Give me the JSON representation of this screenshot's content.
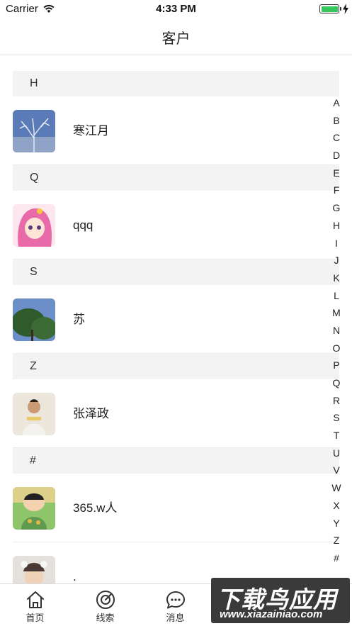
{
  "status_bar": {
    "carrier": "Carrier",
    "time": "4:33 PM",
    "battery_percent": 100,
    "battery_color": "#35c759"
  },
  "nav": {
    "title": "客户"
  },
  "sections": [
    {
      "letter": "H",
      "contacts": [
        {
          "name": "寒江月",
          "avatar": "winter-tree-photo"
        }
      ]
    },
    {
      "letter": "Q",
      "contacts": [
        {
          "name": "qqq",
          "avatar": "pink-anime-girl"
        }
      ]
    },
    {
      "letter": "S",
      "contacts": [
        {
          "name": "苏",
          "avatar": "tree-sky-photo"
        }
      ]
    },
    {
      "letter": "Z",
      "contacts": [
        {
          "name": "张泽政",
          "avatar": "person-photo"
        }
      ]
    },
    {
      "letter": "#",
      "contacts": [
        {
          "name": "365.w人",
          "avatar": "cartoon-boy"
        },
        {
          "name": ".",
          "avatar": "child-photo"
        }
      ]
    }
  ],
  "index_letters": [
    "A",
    "B",
    "C",
    "D",
    "E",
    "F",
    "G",
    "H",
    "I",
    "J",
    "K",
    "L",
    "M",
    "N",
    "O",
    "P",
    "Q",
    "R",
    "S",
    "T",
    "U",
    "V",
    "W",
    "X",
    "Y",
    "Z",
    "#"
  ],
  "tabs": [
    {
      "label": "首页",
      "icon": "home-icon"
    },
    {
      "label": "线索",
      "icon": "radar-icon"
    },
    {
      "label": "消息",
      "icon": "chat-bubble-icon"
    }
  ],
  "watermark": {
    "title": "下载鸟应用",
    "url": "www.xiazainiao.com"
  }
}
